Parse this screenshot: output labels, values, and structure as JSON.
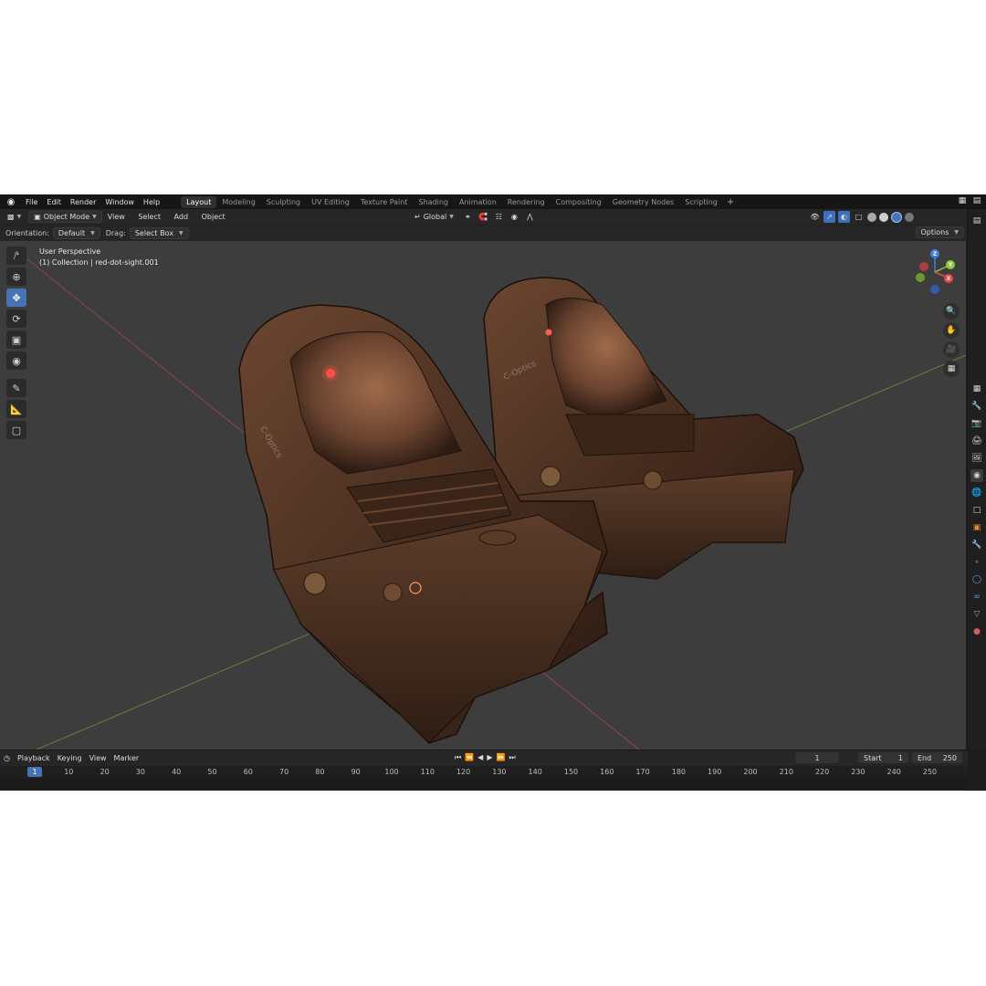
{
  "menubar": {
    "items": [
      "File",
      "Edit",
      "Render",
      "Window",
      "Help"
    ],
    "workspaces": [
      "Layout",
      "Modeling",
      "Sculpting",
      "UV Editing",
      "Texture Paint",
      "Shading",
      "Animation",
      "Rendering",
      "Compositing",
      "Geometry Nodes",
      "Scripting"
    ],
    "active_workspace": "Layout",
    "add_tab": "+"
  },
  "header": {
    "mode": "Object Mode",
    "menus": [
      "View",
      "Select",
      "Add",
      "Object"
    ],
    "transform_orientation": "Global"
  },
  "tool_settings": {
    "orientation_label": "Orientation:",
    "orientation_value": "Default",
    "drag_label": "Drag:",
    "drag_value": "Select Box",
    "options_label": "Options"
  },
  "viewport": {
    "perspective_label": "User Perspective",
    "collection_label": "(1) Collection | red-dot-sight.001",
    "background_color": "#3d3d3d",
    "brand_text": "C-Optics",
    "gizmo_axes": [
      "Z",
      "Y",
      "X"
    ]
  },
  "timeline": {
    "menus": [
      "Playback",
      "Keying",
      "View",
      "Marker"
    ],
    "current_frame": "1",
    "start_label": "Start",
    "start_value": "1",
    "end_label": "End",
    "end_value": "250",
    "ruler_current": "1",
    "ruler_ticks": [
      "10",
      "20",
      "30",
      "40",
      "50",
      "60",
      "70",
      "80",
      "90",
      "100",
      "110",
      "120",
      "130",
      "140",
      "150",
      "160",
      "170",
      "180",
      "190",
      "200",
      "210",
      "220",
      "230",
      "240",
      "250"
    ]
  },
  "colors": {
    "accent": "#4772b3",
    "axis_x": "#e04848",
    "axis_y": "#8ccc3c",
    "axis_z": "#3f7fe0"
  }
}
